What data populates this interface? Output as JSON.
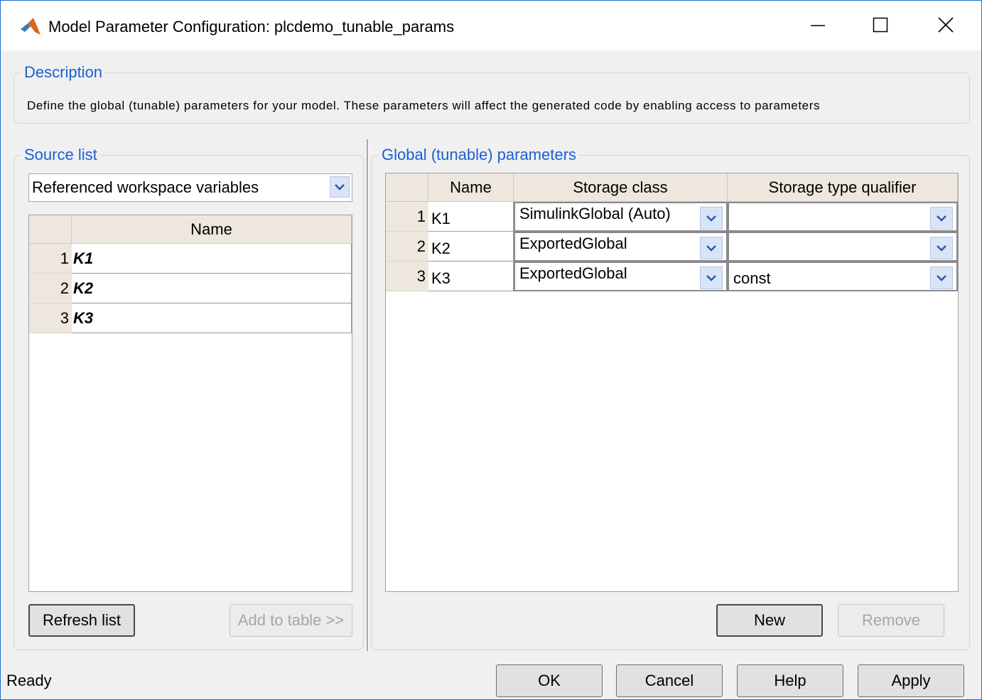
{
  "window": {
    "title": "Model Parameter Configuration: plcdemo_tunable_params",
    "minimize_icon": "minimize-icon",
    "maximize_icon": "maximize-icon",
    "close_icon": "close-icon"
  },
  "description": {
    "legend": "Description",
    "text": "Define the global (tunable) parameters for your model. These parameters will affect the generated code by enabling access to parameters"
  },
  "source_list": {
    "legend": "Source list",
    "selected_source": "Referenced workspace variables",
    "table": {
      "header_name": "Name",
      "rows": [
        {
          "num": "1",
          "name": "K1"
        },
        {
          "num": "2",
          "name": "K2"
        },
        {
          "num": "3",
          "name": "K3"
        }
      ]
    },
    "refresh_label": "Refresh list",
    "add_label": "Add to table >>"
  },
  "global_params": {
    "legend": "Global (tunable) parameters",
    "headers": {
      "name": "Name",
      "storage_class": "Storage class",
      "qualifier": "Storage type qualifier"
    },
    "rows": [
      {
        "num": "1",
        "name": "K1",
        "storage_class": "SimulinkGlobal (Auto)",
        "qualifier": ""
      },
      {
        "num": "2",
        "name": "K2",
        "storage_class": "ExportedGlobal",
        "qualifier": ""
      },
      {
        "num": "3",
        "name": "K3",
        "storage_class": "ExportedGlobal",
        "qualifier": "const"
      }
    ],
    "new_label": "New",
    "remove_label": "Remove"
  },
  "footer": {
    "status": "Ready",
    "ok_label": "OK",
    "cancel_label": "Cancel",
    "help_label": "Help",
    "apply_label": "Apply"
  },
  "colors": {
    "legend_blue": "#1a5fd6",
    "header_beige": "#ede7dd",
    "window_border": "#1c6fd2",
    "dropdown_arrow_bg": "#d9e4f6"
  }
}
